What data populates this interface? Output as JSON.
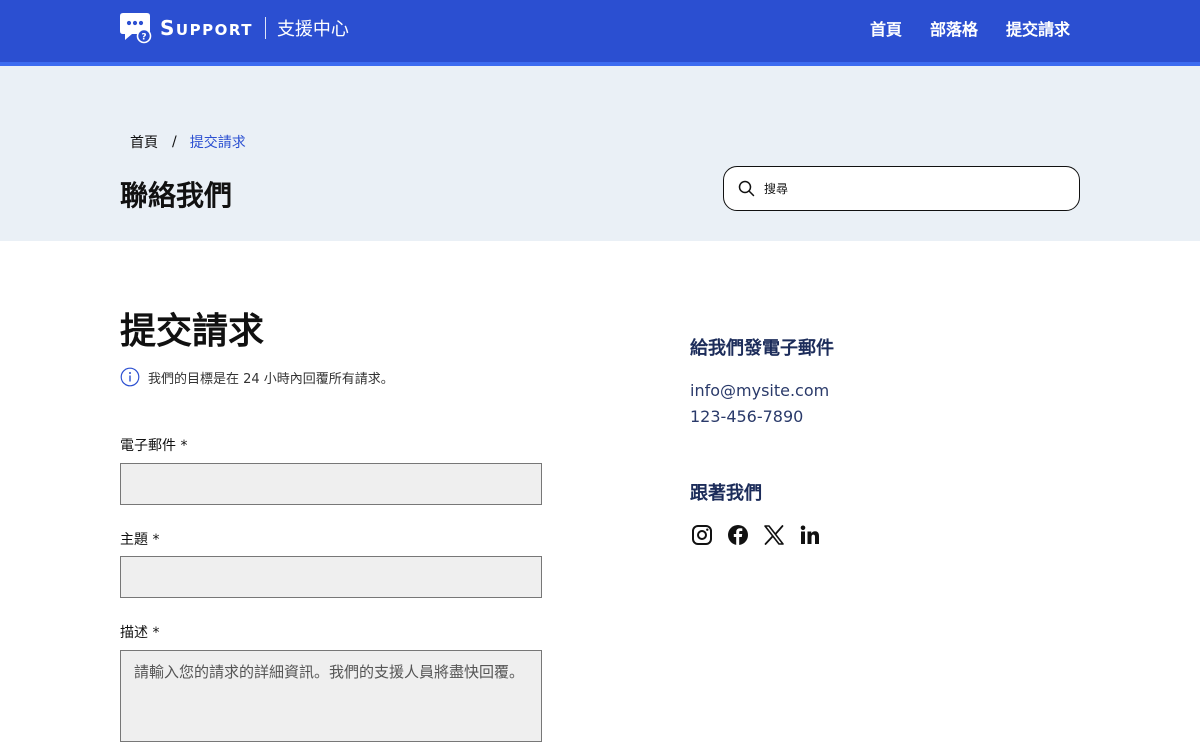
{
  "header": {
    "brand": "SUPPORT",
    "brand_first": "S",
    "brand_rest": "UPPORT",
    "subtitle": "支援中心",
    "nav": [
      "首頁",
      "部落格",
      "提交請求"
    ],
    "bg_color": "#2b4fd1"
  },
  "breadcrumb": {
    "home": "首頁",
    "separator": "/",
    "current": "提交請求"
  },
  "page_title": "聯絡我們",
  "search": {
    "placeholder": "搜尋",
    "icon": "search-icon"
  },
  "form": {
    "title": "提交請求",
    "notice": "我們的目標是在 24 小時內回覆所有請求。",
    "fields": {
      "email_label": "電子郵件 *",
      "subject_label": "主題 *",
      "description_label": "描述 *",
      "description_placeholder": "請輸入您的請求的詳細資訊。我們的支援人員將盡快回覆。"
    }
  },
  "contact": {
    "email_heading": "給我們發電子郵件",
    "email": "info@mysite.com",
    "phone": "123-456-7890",
    "follow_heading": "跟著我們",
    "social_icons": [
      "instagram-icon",
      "facebook-icon",
      "x-icon",
      "linkedin-icon"
    ]
  }
}
